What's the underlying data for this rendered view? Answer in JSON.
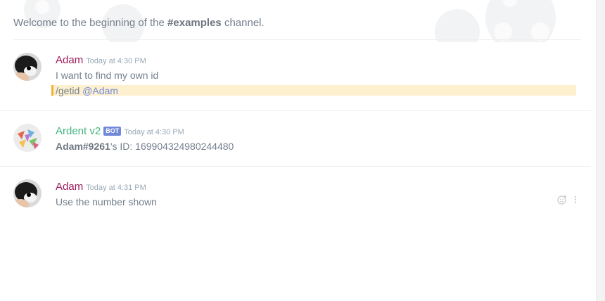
{
  "welcome": {
    "prefix": "Welcome to the beginning of the",
    "channel": "#examples",
    "suffix": "channel."
  },
  "messages": [
    {
      "author": "Adam",
      "author_color": "#9c1a5b",
      "timestamp": "Today at 4:30 PM",
      "lines": [
        "I want to find my own id"
      ],
      "command": "/getid",
      "mention": "@Adam"
    },
    {
      "author": "Ardent v2",
      "author_color": "#43b581",
      "bot_tag": "BOT",
      "timestamp": "Today at 4:30 PM",
      "user_tag": "Adam#9261",
      "id_text": "'s ID: 169904324980244480"
    },
    {
      "author": "Adam",
      "author_color": "#9c1a5b",
      "timestamp": "Today at 4:31 PM",
      "lines": [
        "Use the number shown"
      ]
    }
  ],
  "icons": {
    "reaction": "add-reaction-icon",
    "more": "more-options-icon"
  }
}
